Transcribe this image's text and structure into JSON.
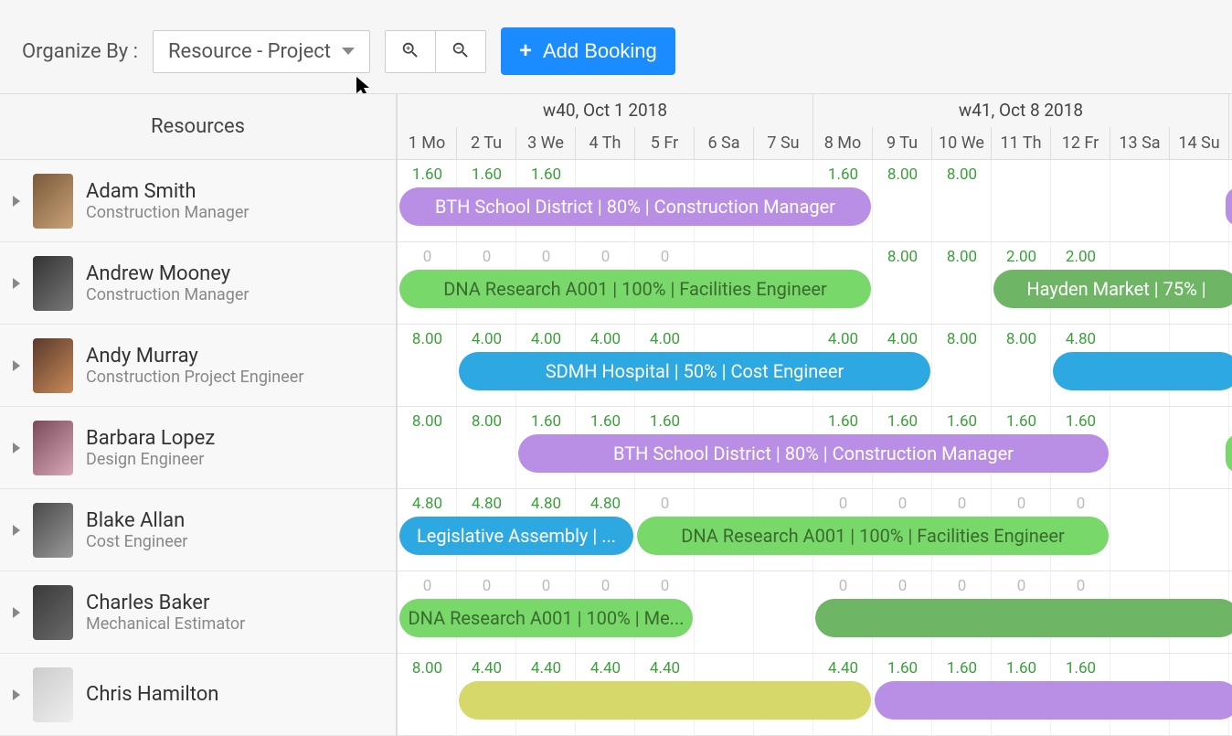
{
  "toolbar": {
    "organize_label": "Organize By :",
    "dropdown_value": "Resource - Project",
    "add_booking_label": "Add Booking"
  },
  "resources_header": "Resources",
  "weeks": [
    {
      "label": "w40, Oct 1 2018",
      "span": 7
    },
    {
      "label": "w41, Oct 8 2018",
      "span": 7
    }
  ],
  "days": [
    "1 Mo",
    "2 Tu",
    "3 We",
    "4 Th",
    "5 Fr",
    "6 Sa",
    "7 Su",
    "8 Mo",
    "9 Tu",
    "10 We",
    "11 Th",
    "12 Fr",
    "13 Sa",
    "14 Su"
  ],
  "day_width": 65,
  "resources": [
    {
      "name": "Adam Smith",
      "role": "Construction Manager",
      "avatar": "a1",
      "hours": [
        "1.60",
        "1.60",
        "1.60",
        "",
        "",
        "",
        "",
        "1.60",
        "8.00",
        "8.00",
        "",
        "",
        "",
        ""
      ],
      "bookings": [
        {
          "label": "BTH School District | 80% | Construction Manager",
          "start": 0,
          "span": 8,
          "color": "purple"
        },
        {
          "label": "",
          "start": 13.9,
          "span": 0.3,
          "color": "purple"
        }
      ]
    },
    {
      "name": "Andrew Mooney",
      "role": "Construction Manager",
      "avatar": "a2",
      "hours": [
        "0",
        "0",
        "0",
        "0",
        "0",
        "",
        "",
        "",
        "8.00",
        "8.00",
        "2.00",
        "2.00",
        "",
        ""
      ],
      "bookings": [
        {
          "label": "DNA Research A001 | 100% | Facilities Engineer",
          "start": 0,
          "span": 8,
          "color": "green"
        },
        {
          "label": "Hayden Market | 75% | ",
          "start": 10,
          "span": 4.2,
          "color": "green-dark"
        }
      ]
    },
    {
      "name": "Andy Murray",
      "role": "Construction Project Engineer",
      "avatar": "a3",
      "hours": [
        "8.00",
        "4.00",
        "4.00",
        "4.00",
        "4.00",
        "",
        "",
        "4.00",
        "4.00",
        "8.00",
        "8.00",
        "4.80",
        "",
        ""
      ],
      "bookings": [
        {
          "label": "SDMH Hospital | 50% | Cost Engineer",
          "start": 1,
          "span": 8,
          "color": "blue"
        },
        {
          "label": "",
          "start": 11,
          "span": 3.2,
          "color": "blue"
        }
      ]
    },
    {
      "name": "Barbara Lopez",
      "role": "Design Engineer",
      "avatar": "a4",
      "hours": [
        "8.00",
        "8.00",
        "1.60",
        "1.60",
        "1.60",
        "",
        "",
        "1.60",
        "1.60",
        "1.60",
        "1.60",
        "1.60",
        "",
        ""
      ],
      "bookings": [
        {
          "label": "BTH School District | 80% | Construction Manager",
          "start": 2,
          "span": 10,
          "color": "purple"
        },
        {
          "label": "",
          "start": 13.9,
          "span": 0.3,
          "color": "green"
        }
      ]
    },
    {
      "name": "Blake Allan",
      "role": "Cost Engineer",
      "avatar": "a5",
      "hours": [
        "4.80",
        "4.80",
        "4.80",
        "4.80",
        "0",
        "",
        "",
        "0",
        "0",
        "0",
        "0",
        "0",
        "",
        ""
      ],
      "bookings": [
        {
          "label": "Legislative Assembly | ...",
          "start": 0,
          "span": 4,
          "color": "blue"
        },
        {
          "label": "DNA Research A001 | 100% | Facilities Engineer",
          "start": 4,
          "span": 8,
          "color": "green"
        }
      ]
    },
    {
      "name": "Charles Baker",
      "role": "Mechanical Estimator",
      "avatar": "a6",
      "hours": [
        "0",
        "0",
        "0",
        "0",
        "0",
        "",
        "",
        "0",
        "0",
        "0",
        "0",
        "0",
        "",
        ""
      ],
      "bookings": [
        {
          "label": "DNA Research A001 | 100% | Me...",
          "start": 0,
          "span": 5,
          "color": "green"
        },
        {
          "label": "",
          "start": 7,
          "span": 7.2,
          "color": "green-dark"
        }
      ]
    },
    {
      "name": "Chris Hamilton",
      "role": "",
      "avatar": "a7",
      "hours": [
        "8.00",
        "4.40",
        "4.40",
        "4.40",
        "4.40",
        "",
        "",
        "4.40",
        "1.60",
        "1.60",
        "1.60",
        "1.60",
        "",
        ""
      ],
      "bookings": [
        {
          "label": "",
          "start": 1,
          "span": 7,
          "color": "yellow"
        },
        {
          "label": "",
          "start": 8,
          "span": 6.2,
          "color": "purple"
        }
      ]
    }
  ]
}
